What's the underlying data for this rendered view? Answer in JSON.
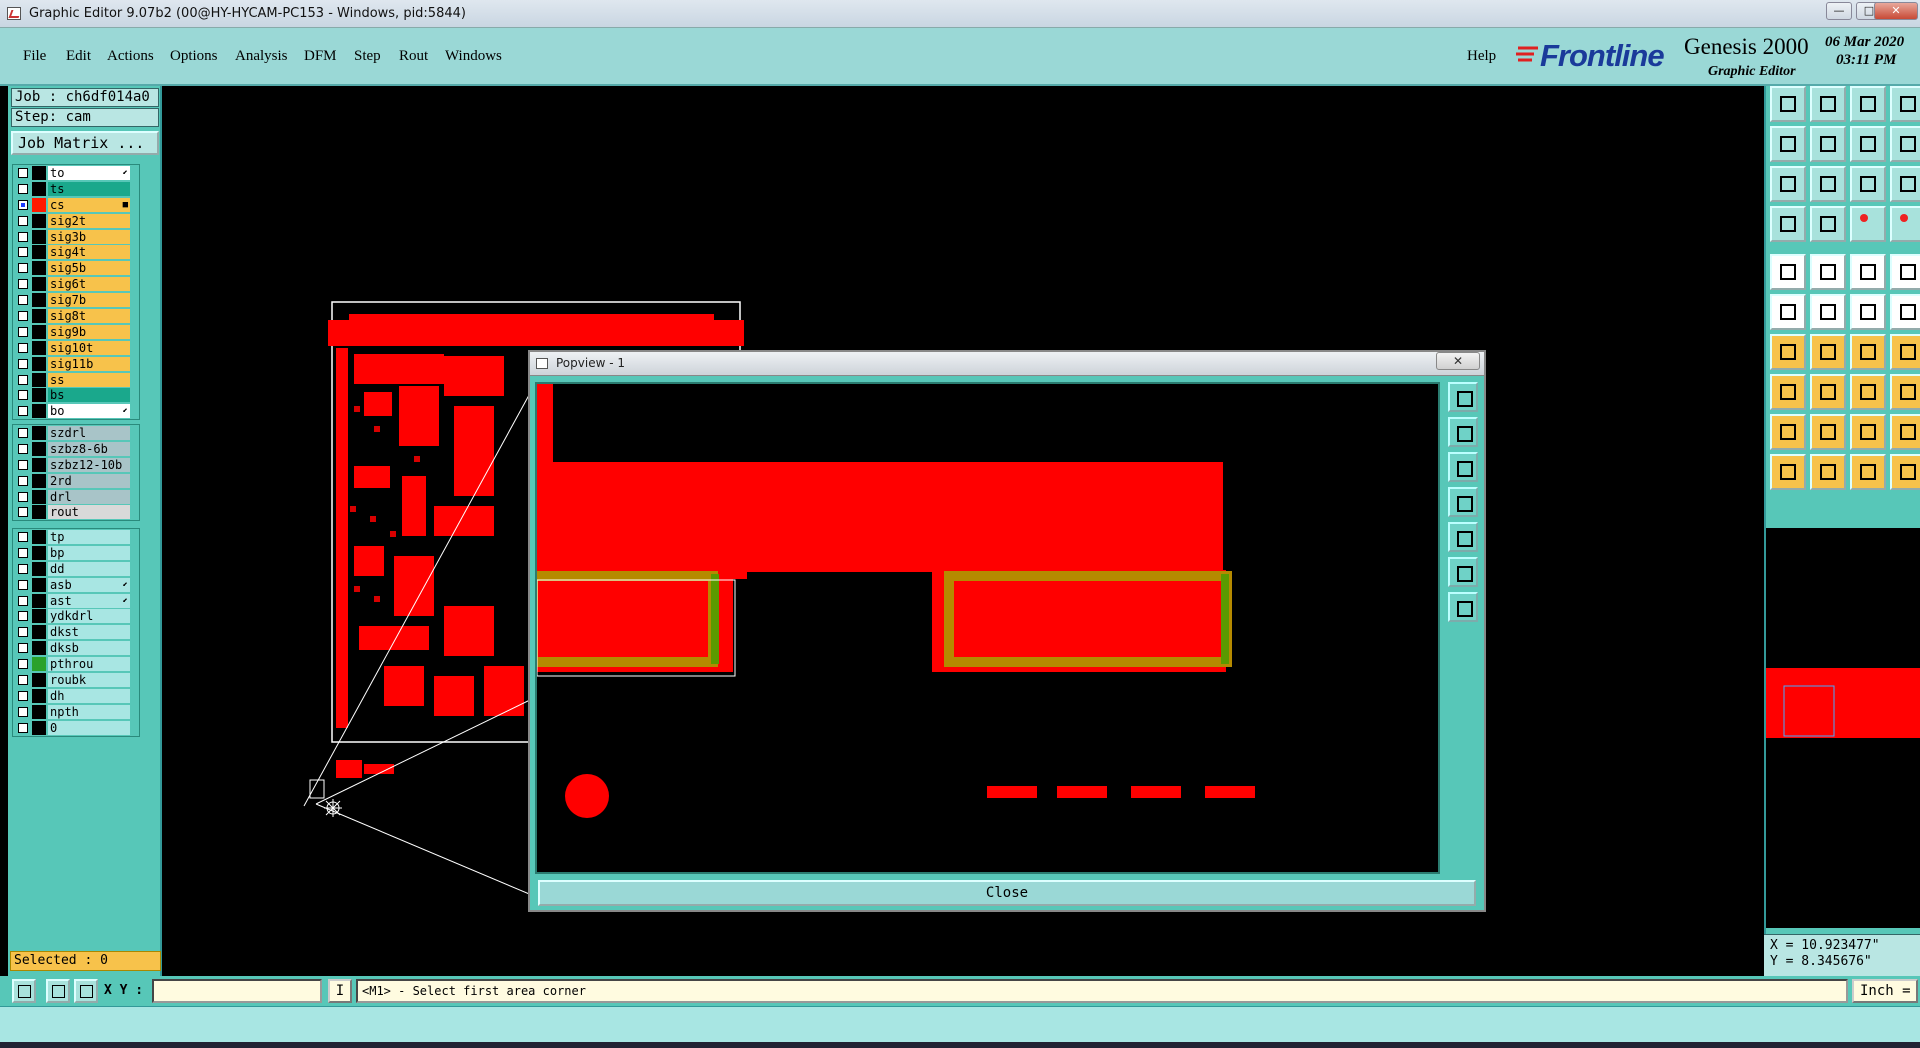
{
  "window": {
    "title": "Graphic Editor 9.07b2 (00@HY-HYCAM-PC153 - Windows, pid:5844)",
    "min": "—",
    "max": "□",
    "close": "✕"
  },
  "menu": {
    "items": [
      {
        "label": "File"
      },
      {
        "label": "Edit"
      },
      {
        "label": "Actions"
      },
      {
        "label": "Options"
      },
      {
        "label": "Analysis"
      },
      {
        "label": "DFM"
      },
      {
        "label": "Step"
      },
      {
        "label": "Rout"
      },
      {
        "label": "Windows"
      }
    ],
    "help": "Help"
  },
  "brand": {
    "logo": "Frontline",
    "product": "Genesis 2000",
    "subtitle": "Graphic Editor",
    "date": "06 Mar 2020",
    "time": "03:11 PM"
  },
  "job": {
    "job_label": "Job : ch6df014a0",
    "step_label": "Step: cam",
    "matrix_button": "Job Matrix ..."
  },
  "layers": {
    "group1": [
      {
        "name": "to",
        "color": "#ffffff",
        "swatch": "#000000",
        "mark": "⬋"
      },
      {
        "name": "ts",
        "color": "#1aa88c",
        "swatch": "#000000",
        "mark": ""
      },
      {
        "name": "cs",
        "color": "#f7c24b",
        "swatch": "#ff1a00",
        "mark": "■",
        "on": true
      },
      {
        "name": "sig2t",
        "color": "#f7c24b",
        "swatch": "#000000",
        "mark": ""
      },
      {
        "name": "sig3b",
        "color": "#f7c24b",
        "swatch": "#000000",
        "mark": ""
      },
      {
        "name": "sig4t",
        "color": "#f7c24b",
        "swatch": "#000000",
        "mark": ""
      },
      {
        "name": "sig5b",
        "color": "#f7c24b",
        "swatch": "#000000",
        "mark": ""
      },
      {
        "name": "sig6t",
        "color": "#f7c24b",
        "swatch": "#000000",
        "mark": ""
      },
      {
        "name": "sig7b",
        "color": "#f7c24b",
        "swatch": "#000000",
        "mark": ""
      },
      {
        "name": "sig8t",
        "color": "#f7c24b",
        "swatch": "#000000",
        "mark": ""
      },
      {
        "name": "sig9b",
        "color": "#f7c24b",
        "swatch": "#000000",
        "mark": ""
      },
      {
        "name": "sig10t",
        "color": "#f7c24b",
        "swatch": "#000000",
        "mark": ""
      },
      {
        "name": "sig11b",
        "color": "#f7c24b",
        "swatch": "#000000",
        "mark": ""
      },
      {
        "name": "ss",
        "color": "#f7c24b",
        "swatch": "#000000",
        "mark": ""
      },
      {
        "name": "bs",
        "color": "#1aa88c",
        "swatch": "#000000",
        "mark": ""
      },
      {
        "name": "bo",
        "color": "#ffffff",
        "swatch": "#000000",
        "mark": "⬋"
      }
    ],
    "group2": [
      {
        "name": "szdrl",
        "color": "#a8c4c8",
        "swatch": "#000000",
        "mark": ""
      },
      {
        "name": "szbz8-6b",
        "color": "#a8c4c8",
        "swatch": "#000000",
        "mark": ""
      },
      {
        "name": "szbz12-10b",
        "color": "#a8c4c8",
        "swatch": "#000000",
        "mark": ""
      },
      {
        "name": "2rd",
        "color": "#a8c4c8",
        "swatch": "#000000",
        "mark": ""
      },
      {
        "name": "drl",
        "color": "#a8c4c8",
        "swatch": "#000000",
        "mark": ""
      },
      {
        "name": "rout",
        "color": "#d9d9d9",
        "swatch": "#000000",
        "mark": ""
      }
    ],
    "group3": [
      {
        "name": "tp",
        "color": "#a8e6e3",
        "swatch": "#000000",
        "mark": ""
      },
      {
        "name": "bp",
        "color": "#a8e6e3",
        "swatch": "#000000",
        "mark": ""
      },
      {
        "name": "dd",
        "color": "#a8e6e3",
        "swatch": "#000000",
        "mark": ""
      },
      {
        "name": "asb",
        "color": "#a8e6e3",
        "swatch": "#000000",
        "mark": "⬋"
      },
      {
        "name": "ast",
        "color": "#a8e6e3",
        "swatch": "#000000",
        "mark": "⬋"
      },
      {
        "name": "ydkdrl",
        "color": "#a8e6e3",
        "swatch": "#000000",
        "mark": ""
      },
      {
        "name": "dkst",
        "color": "#a8e6e3",
        "swatch": "#000000",
        "mark": ""
      },
      {
        "name": "dksb",
        "color": "#a8e6e3",
        "swatch": "#000000",
        "mark": ""
      },
      {
        "name": "pthrou",
        "color": "#a8e6e3",
        "swatch": "#2aa12a",
        "mark": ""
      },
      {
        "name": "roubk",
        "color": "#a8e6e3",
        "swatch": "#000000",
        "mark": ""
      },
      {
        "name": "dh",
        "color": "#a8e6e3",
        "swatch": "#000000",
        "mark": ""
      },
      {
        "name": "npth",
        "color": "#a8e6e3",
        "swatch": "#000000",
        "mark": ""
      },
      {
        "name": "0",
        "color": "#a8e6e3",
        "swatch": "#000000",
        "mark": ""
      }
    ]
  },
  "selected": "Selected : 0",
  "popview": {
    "title": "Popview - 1",
    "close_x": "✕",
    "close_button": "Close"
  },
  "coords": {
    "x": "X = 10.923477\"",
    "y": "Y = 8.345676\""
  },
  "status": {
    "xy_label": "X Y :",
    "xy_value": "",
    "i_button": "I",
    "message": "<M1> - Select first area corner",
    "units": "Inch ="
  },
  "colors": {
    "pcb_copper": "#ff0000",
    "pad_outline": "#b58a00",
    "pad_edge": "#5a9a00",
    "panel": "#57c7b8",
    "menubar": "#9ad8d6"
  }
}
